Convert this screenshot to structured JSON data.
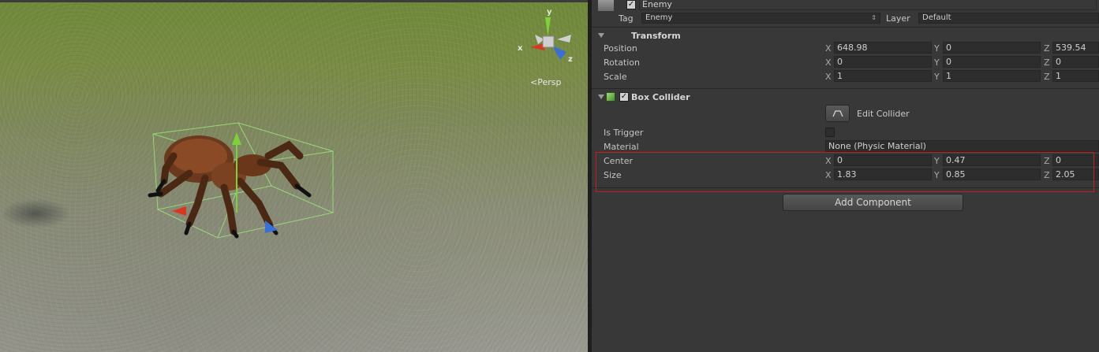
{
  "scene": {
    "gizmo": {
      "y_label": "y",
      "x_label": "x",
      "z_label": "z"
    },
    "persp_label": "Persp"
  },
  "header": {
    "object_name": "Enemy",
    "tag_label": "Tag",
    "tag_value": "Enemy",
    "layer_label": "Layer",
    "layer_value": "Default"
  },
  "transform": {
    "title": "Transform",
    "position": {
      "label": "Position",
      "x": "648.98",
      "y": "0",
      "z": "539.54"
    },
    "rotation": {
      "label": "Rotation",
      "x": "0",
      "y": "0",
      "z": "0"
    },
    "scale": {
      "label": "Scale",
      "x": "1",
      "y": "1",
      "z": "1"
    }
  },
  "box_collider": {
    "title": "Box Collider",
    "edit_collider_label": "Edit Collider",
    "is_trigger_label": "Is Trigger",
    "material_label": "Material",
    "material_value": "None (Physic Material)",
    "center": {
      "label": "Center",
      "x": "0",
      "y": "0.47",
      "z": "0"
    },
    "size": {
      "label": "Size",
      "x": "1.83",
      "y": "0.85",
      "z": "2.05"
    }
  },
  "axes": {
    "x": "X",
    "y": "Y",
    "z": "Z"
  },
  "add_component_label": "Add Component",
  "colors": {
    "highlight": "#c91c1c",
    "gizmo_y": "#7fd13b",
    "gizmo_x": "#d9381e",
    "gizmo_z": "#3a6fd8"
  }
}
